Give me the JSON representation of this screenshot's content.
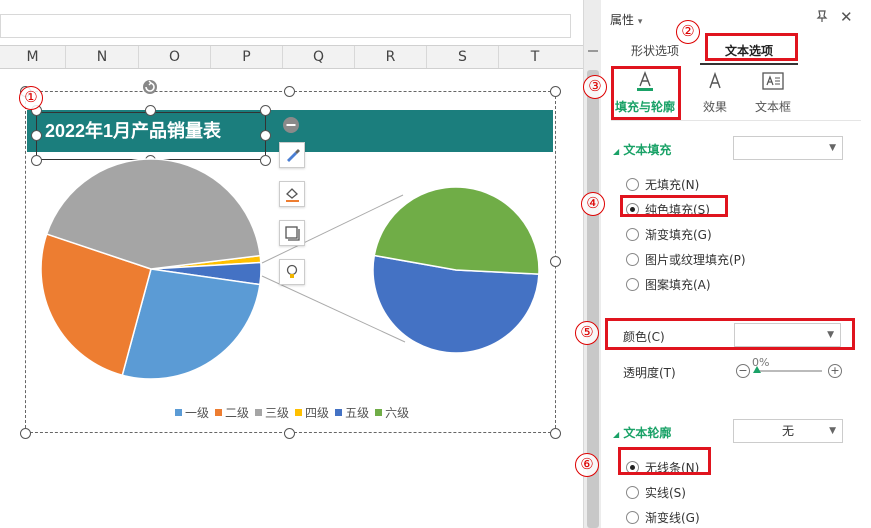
{
  "sheet": {
    "columns": [
      "M",
      "N",
      "O",
      "P",
      "Q",
      "R",
      "S",
      "T"
    ]
  },
  "chart": {
    "title": "2022年1月产品销量表",
    "legend": [
      {
        "label": "一级",
        "color": "#5b9bd5"
      },
      {
        "label": "二级",
        "color": "#ed7d31"
      },
      {
        "label": "三级",
        "color": "#a5a5a5"
      },
      {
        "label": "四级",
        "color": "#ffc000"
      },
      {
        "label": "五级",
        "color": "#4472c4"
      },
      {
        "label": "六级",
        "color": "#70ad47"
      }
    ]
  },
  "chart_data": {
    "type": "pie",
    "categories": [
      "一级",
      "二级",
      "三级",
      "四级",
      "五级",
      "六级"
    ],
    "values": [
      27,
      26,
      43,
      1,
      1.7,
      1.5
    ],
    "title": "2022年1月产品销量表",
    "legend_position": "bottom",
    "secondary_pie": {
      "categories": [
        "五级",
        "六级"
      ],
      "values": [
        52,
        48
      ]
    }
  },
  "markers": [
    "①",
    "②",
    "③",
    "④",
    "⑤",
    "⑥"
  ],
  "panel": {
    "title": "属性",
    "title_caret": "▾",
    "tabs": [
      "形状选项",
      "文本选项"
    ],
    "active_tab": "文本选项",
    "subtabs": [
      "填充与轮廓",
      "效果",
      "文本框"
    ],
    "text_fill": {
      "section": "文本填充",
      "dropdown_value": "",
      "options": [
        "无填充(N)",
        "纯色填充(S)",
        "渐变填充(G)",
        "图片或纹理填充(P)",
        "图案填充(A)"
      ],
      "selected": "纯色填充(S)",
      "color_label": "颜色(C)",
      "color_value": "",
      "transparency_label": "透明度(T)",
      "transparency_value": "0%"
    },
    "text_outline": {
      "section": "文本轮廓",
      "dropdown_value": "无",
      "options": [
        "无线条(N)",
        "实线(S)",
        "渐变线(G)"
      ],
      "selected": "无线条(N)"
    }
  }
}
